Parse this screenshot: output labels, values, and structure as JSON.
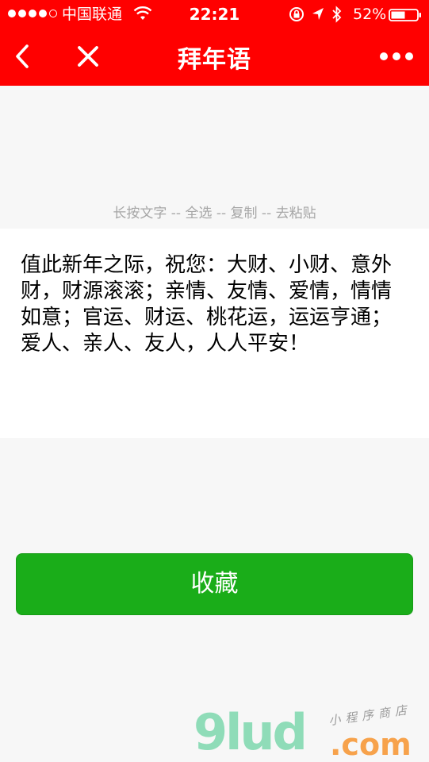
{
  "status_bar": {
    "carrier": "中国联通",
    "time": "22:21",
    "battery": "52%",
    "signal_dots_filled": 4,
    "signal_dots_total": 5
  },
  "nav": {
    "title": "拜年语",
    "back_icon": "chevron-left-icon",
    "close_icon": "close-icon",
    "more_icon": "more-dots-icon"
  },
  "hint": "长按文字 -- 全选 -- 复制 -- 去粘贴",
  "greeting": "值此新年之际，祝您：大财、小财、意外财，财源滚滚；亲情、友情、爱情，情情如意；官运、财运、桃花运，运运亨通；爱人、亲人、友人，人人平安！",
  "button": {
    "label": "收藏"
  },
  "watermark": {
    "logo": "9lud",
    "domain": ".com",
    "tagline": "小程序商店"
  },
  "colors": {
    "header_bg": "#ff0000",
    "button_bg": "#1aad19",
    "page_bg": "#f7f7f7",
    "hint_text": "#a6a6a6"
  }
}
